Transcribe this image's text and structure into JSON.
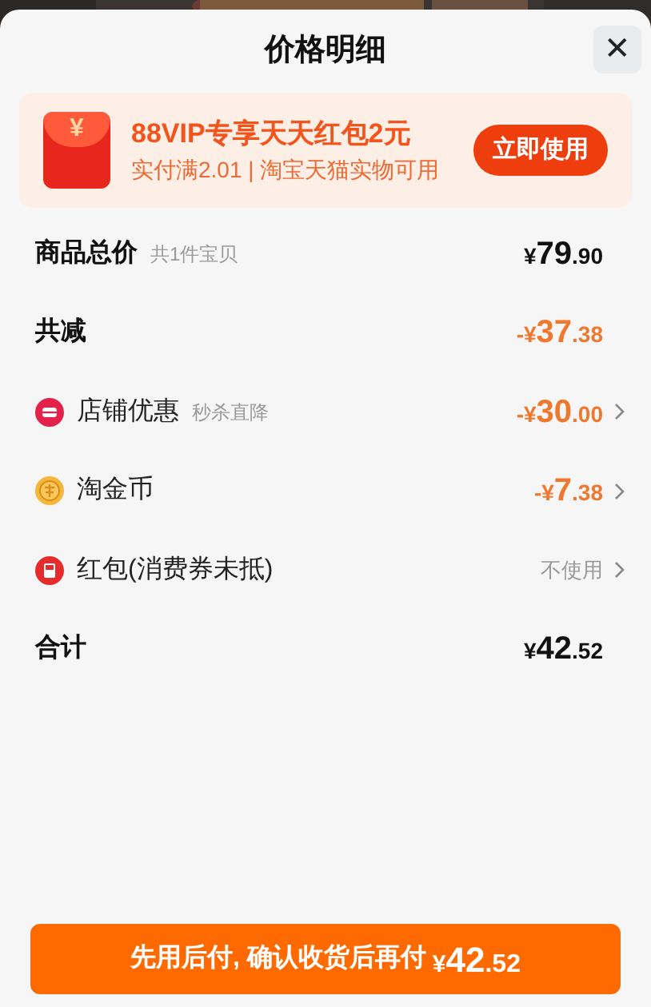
{
  "sheet": {
    "title": "价格明细",
    "close": "✕"
  },
  "promo": {
    "title": "88VIP专享天天红包2元",
    "subtitle": "实付满2.01 | 淘宝天猫实物可用",
    "button": "立即使用",
    "icon": "¥"
  },
  "rows": [
    {
      "kind": "subtotal",
      "label": "商品总价",
      "note": "共1件宝贝",
      "price": {
        "sign": "¥",
        "whole": "79",
        "fraction": ".90"
      },
      "chevron": false
    },
    {
      "kind": "reduction",
      "label": "共减",
      "price": {
        "sign": "-¥",
        "whole": "37",
        "fraction": ".38"
      },
      "chevron": false
    },
    {
      "kind": "shop",
      "label": "店铺优惠",
      "note": "秒杀直降",
      "price": {
        "sign": "-¥",
        "whole": "30",
        "fraction": ".00"
      },
      "chevron": true
    },
    {
      "kind": "coin",
      "label": "淘金币",
      "price": {
        "sign": "-¥",
        "whole": "7",
        "fraction": ".38"
      },
      "chevron": true
    },
    {
      "kind": "packet",
      "label": "红包(消费券未抵)",
      "value": "不使用",
      "chevron": true
    },
    {
      "kind": "total",
      "label": "合计",
      "price": {
        "sign": "¥",
        "whole": "42",
        "fraction": ".52"
      },
      "chevron": false
    }
  ],
  "pay_button": {
    "text": "先用后付, 确认收货后再付",
    "price": {
      "sign": "¥",
      "whole": "42",
      "fraction": ".52"
    }
  }
}
